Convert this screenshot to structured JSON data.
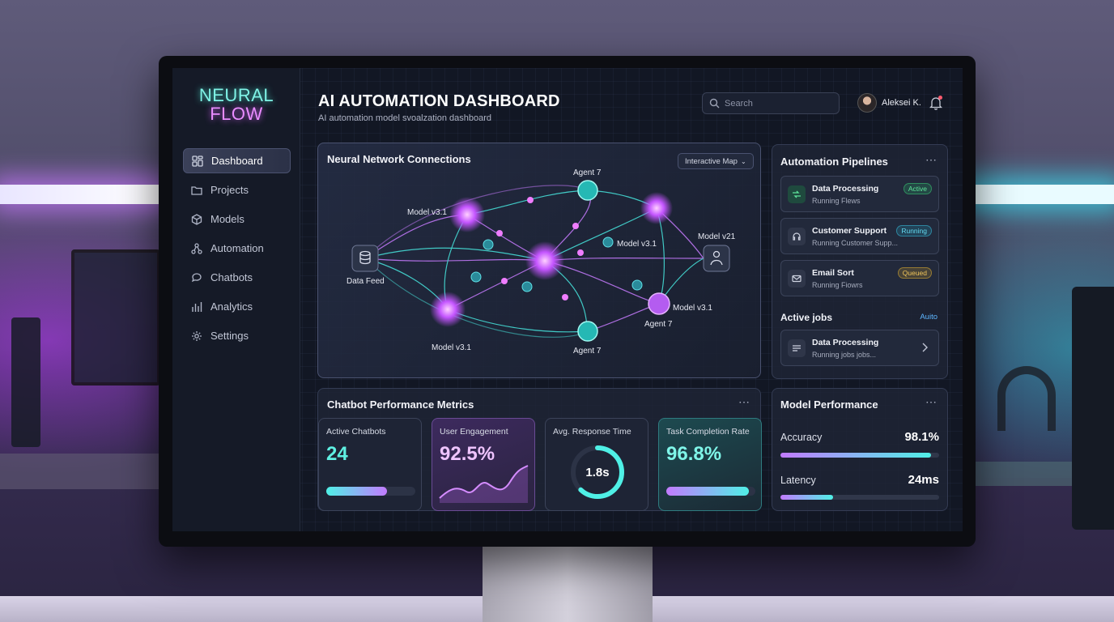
{
  "brand": {
    "line1": "NEURAL",
    "line2": "FLOW"
  },
  "nav": [
    {
      "label": "Dashboard",
      "icon": "dashboard-icon",
      "active": true
    },
    {
      "label": "Projects",
      "icon": "folder-icon"
    },
    {
      "label": "Models",
      "icon": "cube-icon"
    },
    {
      "label": "Automation",
      "icon": "workflow-icon"
    },
    {
      "label": "Chatbots",
      "icon": "chat-icon"
    },
    {
      "label": "Analytics",
      "icon": "bar-chart-icon"
    },
    {
      "label": "Settings",
      "icon": "gear-icon"
    }
  ],
  "header": {
    "title": "AI AUTOMATION DASHBOARD",
    "subtitle": "AI automation model svoalzation dashboard",
    "search_placeholder": "Search",
    "user_name": "Aleksei K."
  },
  "network": {
    "title": "Neural Network Connections",
    "map_button": "Interactive Map",
    "nodes": {
      "model_top_left": "Model v3.1",
      "agent_top": "Agent 7",
      "model_center_right": "Model v3.1",
      "model_right": "Model v21",
      "data_feed": "Data Feed",
      "model_right_lower": "Model v3.1",
      "agent_right_lower": "Agent 7",
      "model_bottom_left": "Model v3.1",
      "agent_bottom": "Agent 7"
    }
  },
  "pipelines": {
    "title": "Automation Pipelines",
    "items": [
      {
        "name": "Data Processing",
        "sub": "Running Flews",
        "status": "Active",
        "icon": "flow-icon"
      },
      {
        "name": "Customer Support",
        "sub": "Running Customer Supp...",
        "status": "Running",
        "icon": "headset-icon"
      },
      {
        "name": "Email Sort",
        "sub": "Running Fiowrs",
        "status": "Queued",
        "icon": "mail-icon"
      }
    ],
    "active_jobs": {
      "title": "Active jobs",
      "auto_label": "Auito",
      "item": {
        "name": "Data Processing",
        "sub": "Running jobs jobs..."
      }
    }
  },
  "metrics": {
    "title": "Chatbot Performance Metrics",
    "active_chatbots": {
      "label": "Active Chatbots",
      "value": "24",
      "fill": 0.68
    },
    "user_engagement": {
      "label": "User Engagement",
      "value": "92.5%"
    },
    "response_time": {
      "label": "Avg. Response Time",
      "value": "1.8s",
      "fill": 0.62
    },
    "task_completion": {
      "label": "Task Completion Rate",
      "value": "96.8%",
      "fill": 0.93
    }
  },
  "model_performance": {
    "title": "Model Performance",
    "accuracy": {
      "label": "Accuracy",
      "value": "98.1%",
      "fill": 0.95
    },
    "latency": {
      "label": "Latency",
      "value": "24ms",
      "fill": 0.33
    }
  },
  "colors": {
    "cyan": "#4ff0e6",
    "purple": "#d58cff",
    "bg": "#121724"
  }
}
